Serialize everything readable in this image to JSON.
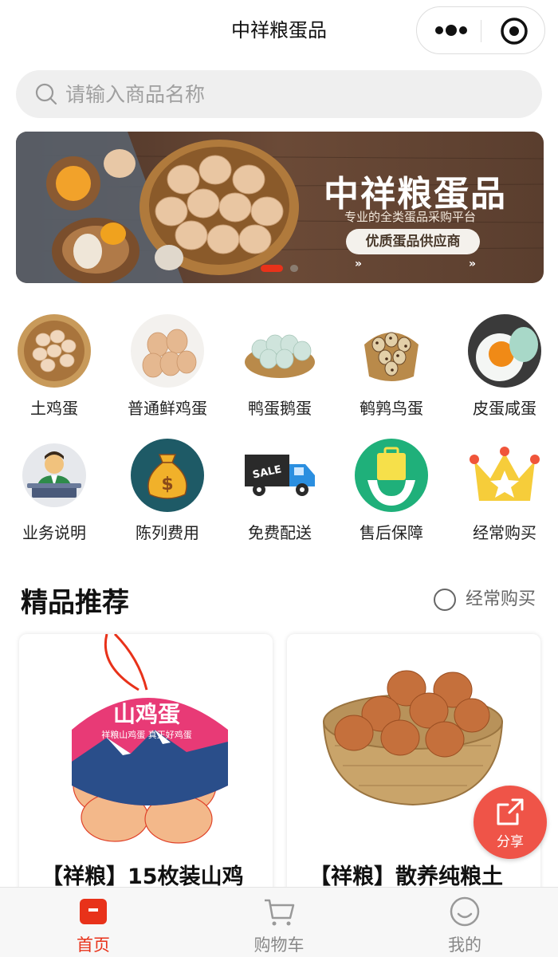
{
  "header": {
    "title": "中祥粮蛋品"
  },
  "search": {
    "placeholder": "请输入商品名称"
  },
  "banner": {
    "title": "中祥粮蛋品",
    "subtitle": "专业的全类蛋品采购平台",
    "pill": "优质蛋品供应商",
    "arrows": "»"
  },
  "categories_row1": [
    {
      "label": "土鸡蛋",
      "icon": "eggs-in-nest-icon"
    },
    {
      "label": "普通鲜鸡蛋",
      "icon": "fresh-eggs-icon"
    },
    {
      "label": "鸭蛋鹅蛋",
      "icon": "duck-eggs-icon"
    },
    {
      "label": "鹌鹑鸟蛋",
      "icon": "quail-eggs-icon"
    },
    {
      "label": "皮蛋咸蛋",
      "icon": "salted-egg-icon"
    }
  ],
  "categories_row2": [
    {
      "label": "业务说明",
      "icon": "service-agent-icon"
    },
    {
      "label": "陈列费用",
      "icon": "money-bag-icon"
    },
    {
      "label": "免费配送",
      "icon": "delivery-truck-icon"
    },
    {
      "label": "售后保障",
      "icon": "after-sales-bag-icon"
    },
    {
      "label": "经常购买",
      "icon": "crown-icon"
    }
  ],
  "section": {
    "title": "精品推荐",
    "right_label": "经常购买"
  },
  "products": [
    {
      "name": "【祥粮】15枚装山鸡",
      "package_text": "山鸡蛋",
      "package_sub": "祥粮山鸡蛋 真正好鸡蛋"
    },
    {
      "name": "【祥粮】散养纯粮土"
    }
  ],
  "share": {
    "label": "分享"
  },
  "tabbar": {
    "tabs": [
      {
        "label": "首页",
        "active": true
      },
      {
        "label": "购物车",
        "active": false
      },
      {
        "label": "我的",
        "active": false
      }
    ]
  },
  "colors": {
    "accent": "#e8321a",
    "share": "#ef5448",
    "tab_inactive": "#888888"
  }
}
